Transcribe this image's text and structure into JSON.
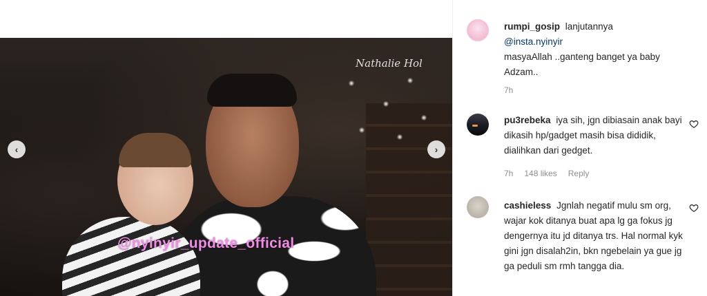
{
  "media": {
    "watermark_top": "Nathalie Hol",
    "watermark_main": "@nyinyir_update_official",
    "prev_icon": "‹",
    "next_icon": "›"
  },
  "comments": [
    {
      "username": "rumpi_gosip",
      "text_before": "lanjutannya",
      "mention": "@insta.nyinyir",
      "text_after": "masyaAllah ..ganteng banget ya baby Adzam..",
      "time": "7h"
    },
    {
      "username": "pu3rebeka",
      "text": "iya sih, jgn dibiasain anak bayi dikasih hp/gadget masih bisa dididik, dialihkan dari gedget.",
      "time": "7h",
      "likes": "148 likes",
      "reply": "Reply"
    },
    {
      "username": "cashieless",
      "text": "Jgnlah negatif mulu sm org, wajar kok ditanya buat apa lg ga fokus jg dengernya itu jd ditanya trs. Hal normal kyk gini jgn disalah2in, bkn ngebelain ya gue jg ga peduli sm rmh tangga dia."
    }
  ]
}
